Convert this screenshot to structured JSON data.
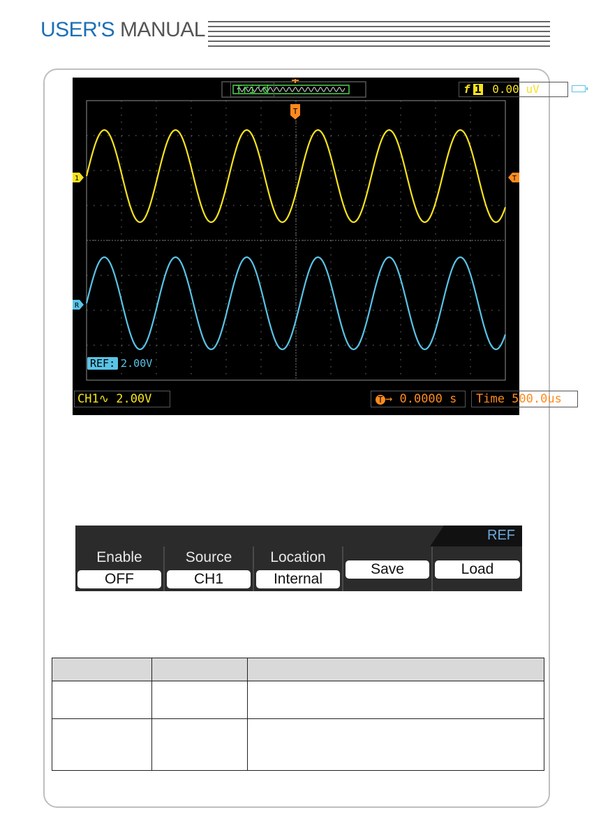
{
  "header": {
    "title_part1": "USER'S",
    "title_part2": "MANUAL"
  },
  "scope": {
    "status": "Tri'd",
    "trigger_edge": "f",
    "trigger_channel": "1",
    "trigger_level": "0.00  uV",
    "ch1_marker": "1",
    "trigger_marker": "T",
    "ref_marker": "R",
    "ref_tag": "REF:",
    "ref_scale": "2.00V",
    "ch1_label": "CH1",
    "ch1_coupling_icon": "ac-wave-icon",
    "ch1_scale": "2.00V",
    "trigger_position": "0.0000 s",
    "timebase": "Time 500.0us",
    "colors": {
      "ch1": "#f5e21e",
      "ref": "#59c3e6",
      "trigger": "#ff8a1e",
      "status": "#4fd24f"
    }
  },
  "menu": {
    "title": "REF",
    "items": [
      {
        "label": "Enable",
        "value": "OFF"
      },
      {
        "label": "Source",
        "value": "CH1"
      },
      {
        "label": "Location",
        "value": "Internal"
      },
      {
        "label": "",
        "value": "Save"
      },
      {
        "label": "",
        "value": "Load"
      }
    ]
  },
  "table": {
    "headers": [
      "",
      "",
      ""
    ],
    "rows": [
      [
        "",
        "",
        ""
      ],
      [
        "",
        "",
        ""
      ]
    ]
  }
}
